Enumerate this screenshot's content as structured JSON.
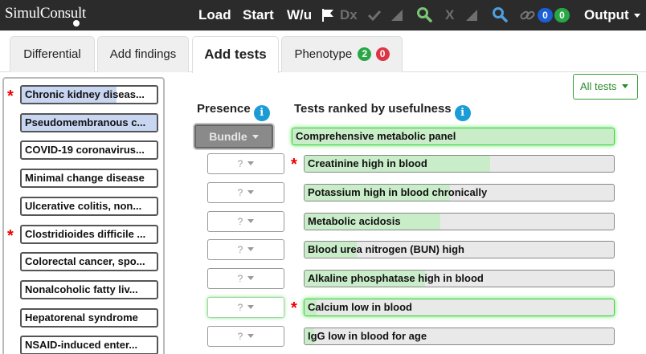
{
  "nav": {
    "logo": "SimulConsult",
    "load": "Load",
    "start": "Start",
    "wu": "W/u",
    "dx": "Dx",
    "x1": "X",
    "x2": "X",
    "badge_blue": "0",
    "badge_green": "0",
    "output": "Output"
  },
  "tabs": [
    {
      "label": "Differential"
    },
    {
      "label": "Add findings"
    },
    {
      "label": "Add tests"
    },
    {
      "label": "Phenotype",
      "badge_green": "2",
      "badge_red": "0"
    }
  ],
  "diagnoses": [
    {
      "label": "Chronic kidney diseas...",
      "starred": true,
      "fill": 0.7
    },
    {
      "label": "Pseudomembranous c...",
      "starred": false,
      "fill": 1.0
    },
    {
      "label": "COVID-19 coronavirus...",
      "starred": false,
      "fill": 0
    },
    {
      "label": "Minimal change disease",
      "starred": false,
      "fill": 0
    },
    {
      "label": "Ulcerative colitis, non...",
      "starred": false,
      "fill": 0
    },
    {
      "label": "Clostridioides difficile ...",
      "starred": true,
      "fill": 0
    },
    {
      "label": "Colorectal cancer, spo...",
      "starred": false,
      "fill": 0
    },
    {
      "label": "Nonalcoholic fatty liv...",
      "starred": false,
      "fill": 0
    },
    {
      "label": "Hepatorenal syndrome",
      "starred": false,
      "fill": 0
    },
    {
      "label": "NSAID-induced enter...",
      "starred": false,
      "fill": 0
    }
  ],
  "headers": {
    "presence": "Presence",
    "tests": "Tests ranked by usefulness",
    "info_glyph": "i"
  },
  "all_tests": "All tests",
  "bundle": "Bundle",
  "panel_test": {
    "label": "Comprehensive metabolic panel"
  },
  "tests": [
    {
      "label": "Creatinine high in blood",
      "starred": true,
      "fill": 0.6,
      "presence": "?",
      "glow": false
    },
    {
      "label": "Potassium high in blood chronically",
      "starred": false,
      "fill": 0.47,
      "presence": "?",
      "glow": false
    },
    {
      "label": "Metabolic acidosis",
      "starred": false,
      "fill": 0.44,
      "presence": "?",
      "glow": false
    },
    {
      "label": "Blood urea nitrogen (BUN) high",
      "starred": false,
      "fill": 0.17,
      "presence": "?",
      "glow": false
    },
    {
      "label": "Alkaline phosphatase high in blood",
      "starred": false,
      "fill": 0.39,
      "presence": "?",
      "glow": false
    },
    {
      "label": "Calcium low in blood",
      "starred": true,
      "fill": 0.04,
      "presence": "?",
      "glow": true
    },
    {
      "label": "IgG low in blood for age",
      "starred": false,
      "fill": 0.03,
      "presence": "?",
      "glow": false
    }
  ],
  "colors": {
    "navbar": "#2b2b2b",
    "dx_selected": "#c8d6f2",
    "test_fill": "#c9ecc9",
    "star": "#ee0000",
    "info": "#1a9cd6",
    "badge_green": "#28a745",
    "badge_red": "#dc3545",
    "badge_blue": "#1a5fd6"
  }
}
